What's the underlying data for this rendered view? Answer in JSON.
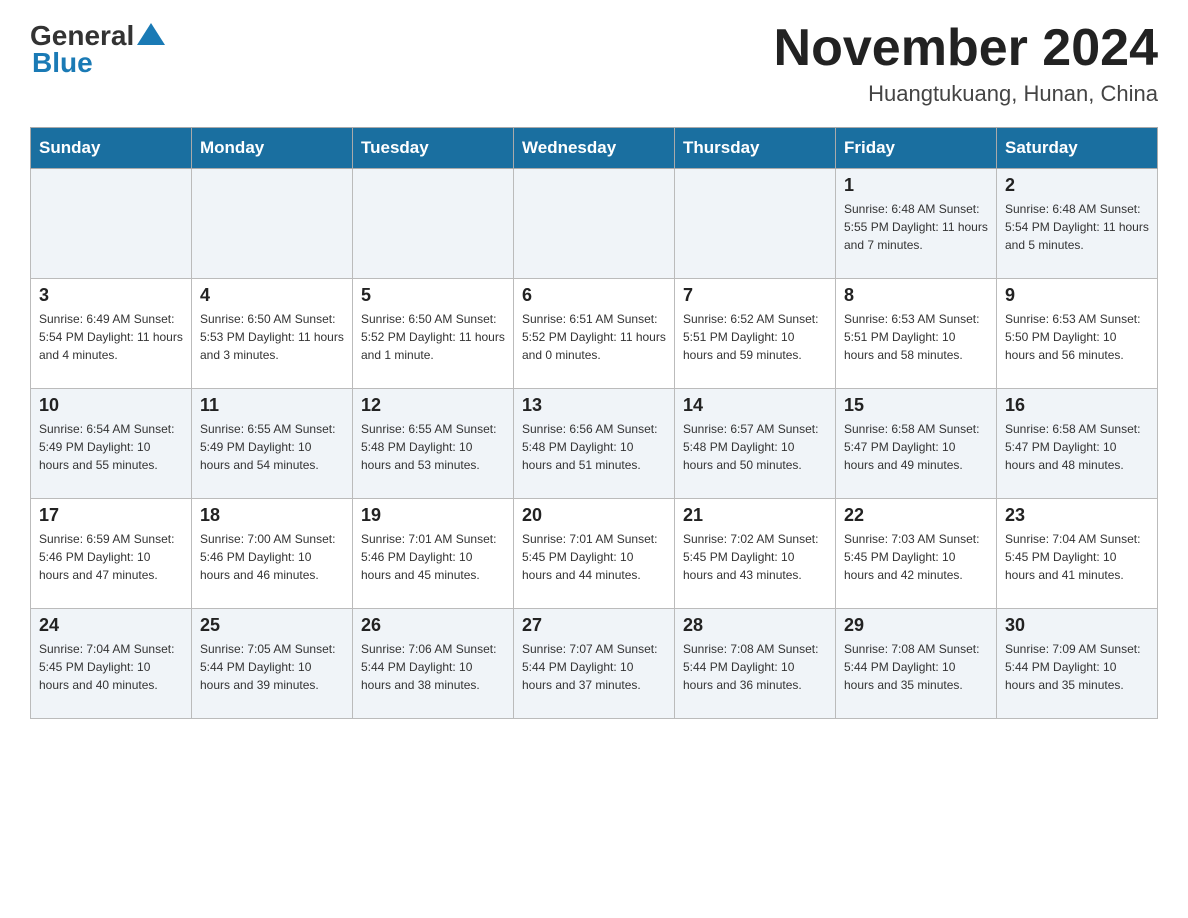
{
  "logo": {
    "general": "General",
    "blue": "Blue"
  },
  "header": {
    "month_title": "November 2024",
    "location": "Huangtukuang, Hunan, China"
  },
  "days_of_week": [
    "Sunday",
    "Monday",
    "Tuesday",
    "Wednesday",
    "Thursday",
    "Friday",
    "Saturday"
  ],
  "weeks": [
    {
      "days": [
        {
          "num": "",
          "info": ""
        },
        {
          "num": "",
          "info": ""
        },
        {
          "num": "",
          "info": ""
        },
        {
          "num": "",
          "info": ""
        },
        {
          "num": "",
          "info": ""
        },
        {
          "num": "1",
          "info": "Sunrise: 6:48 AM\nSunset: 5:55 PM\nDaylight: 11 hours and 7 minutes."
        },
        {
          "num": "2",
          "info": "Sunrise: 6:48 AM\nSunset: 5:54 PM\nDaylight: 11 hours and 5 minutes."
        }
      ]
    },
    {
      "days": [
        {
          "num": "3",
          "info": "Sunrise: 6:49 AM\nSunset: 5:54 PM\nDaylight: 11 hours and 4 minutes."
        },
        {
          "num": "4",
          "info": "Sunrise: 6:50 AM\nSunset: 5:53 PM\nDaylight: 11 hours and 3 minutes."
        },
        {
          "num": "5",
          "info": "Sunrise: 6:50 AM\nSunset: 5:52 PM\nDaylight: 11 hours and 1 minute."
        },
        {
          "num": "6",
          "info": "Sunrise: 6:51 AM\nSunset: 5:52 PM\nDaylight: 11 hours and 0 minutes."
        },
        {
          "num": "7",
          "info": "Sunrise: 6:52 AM\nSunset: 5:51 PM\nDaylight: 10 hours and 59 minutes."
        },
        {
          "num": "8",
          "info": "Sunrise: 6:53 AM\nSunset: 5:51 PM\nDaylight: 10 hours and 58 minutes."
        },
        {
          "num": "9",
          "info": "Sunrise: 6:53 AM\nSunset: 5:50 PM\nDaylight: 10 hours and 56 minutes."
        }
      ]
    },
    {
      "days": [
        {
          "num": "10",
          "info": "Sunrise: 6:54 AM\nSunset: 5:49 PM\nDaylight: 10 hours and 55 minutes."
        },
        {
          "num": "11",
          "info": "Sunrise: 6:55 AM\nSunset: 5:49 PM\nDaylight: 10 hours and 54 minutes."
        },
        {
          "num": "12",
          "info": "Sunrise: 6:55 AM\nSunset: 5:48 PM\nDaylight: 10 hours and 53 minutes."
        },
        {
          "num": "13",
          "info": "Sunrise: 6:56 AM\nSunset: 5:48 PM\nDaylight: 10 hours and 51 minutes."
        },
        {
          "num": "14",
          "info": "Sunrise: 6:57 AM\nSunset: 5:48 PM\nDaylight: 10 hours and 50 minutes."
        },
        {
          "num": "15",
          "info": "Sunrise: 6:58 AM\nSunset: 5:47 PM\nDaylight: 10 hours and 49 minutes."
        },
        {
          "num": "16",
          "info": "Sunrise: 6:58 AM\nSunset: 5:47 PM\nDaylight: 10 hours and 48 minutes."
        }
      ]
    },
    {
      "days": [
        {
          "num": "17",
          "info": "Sunrise: 6:59 AM\nSunset: 5:46 PM\nDaylight: 10 hours and 47 minutes."
        },
        {
          "num": "18",
          "info": "Sunrise: 7:00 AM\nSunset: 5:46 PM\nDaylight: 10 hours and 46 minutes."
        },
        {
          "num": "19",
          "info": "Sunrise: 7:01 AM\nSunset: 5:46 PM\nDaylight: 10 hours and 45 minutes."
        },
        {
          "num": "20",
          "info": "Sunrise: 7:01 AM\nSunset: 5:45 PM\nDaylight: 10 hours and 44 minutes."
        },
        {
          "num": "21",
          "info": "Sunrise: 7:02 AM\nSunset: 5:45 PM\nDaylight: 10 hours and 43 minutes."
        },
        {
          "num": "22",
          "info": "Sunrise: 7:03 AM\nSunset: 5:45 PM\nDaylight: 10 hours and 42 minutes."
        },
        {
          "num": "23",
          "info": "Sunrise: 7:04 AM\nSunset: 5:45 PM\nDaylight: 10 hours and 41 minutes."
        }
      ]
    },
    {
      "days": [
        {
          "num": "24",
          "info": "Sunrise: 7:04 AM\nSunset: 5:45 PM\nDaylight: 10 hours and 40 minutes."
        },
        {
          "num": "25",
          "info": "Sunrise: 7:05 AM\nSunset: 5:44 PM\nDaylight: 10 hours and 39 minutes."
        },
        {
          "num": "26",
          "info": "Sunrise: 7:06 AM\nSunset: 5:44 PM\nDaylight: 10 hours and 38 minutes."
        },
        {
          "num": "27",
          "info": "Sunrise: 7:07 AM\nSunset: 5:44 PM\nDaylight: 10 hours and 37 minutes."
        },
        {
          "num": "28",
          "info": "Sunrise: 7:08 AM\nSunset: 5:44 PM\nDaylight: 10 hours and 36 minutes."
        },
        {
          "num": "29",
          "info": "Sunrise: 7:08 AM\nSunset: 5:44 PM\nDaylight: 10 hours and 35 minutes."
        },
        {
          "num": "30",
          "info": "Sunrise: 7:09 AM\nSunset: 5:44 PM\nDaylight: 10 hours and 35 minutes."
        }
      ]
    }
  ]
}
